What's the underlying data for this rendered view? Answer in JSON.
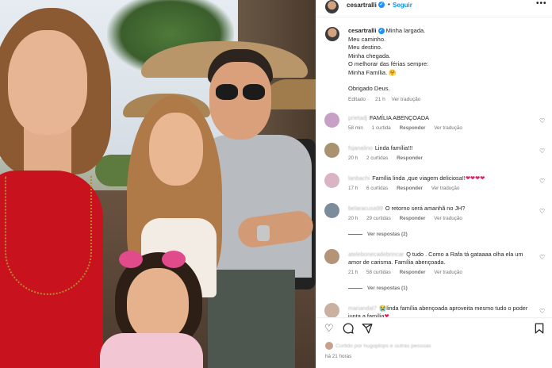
{
  "post": {
    "username": "cesartralli",
    "follow_label": "Seguir",
    "more_label": "•••",
    "caption": {
      "username": "cesartralli",
      "lines": [
        "Minha largada.",
        "Meu caminho.",
        "Meu destino.",
        "Minha chegada.",
        "O melhorar das férias sempre:",
        "Minha Família. 🤗",
        "",
        "Obrigado Deus."
      ],
      "edited": "Editado",
      "age": "21 h",
      "translate": "Ver tradução"
    },
    "comments": [
      {
        "user": "prietadj",
        "text": "FAMÍLIA ABENÇOADA",
        "age": "58 min",
        "likes": "1 curtida",
        "reply": "Responder",
        "translate": "Ver tradução",
        "avatar_color": "#c7a0c6"
      },
      {
        "user": "fsjanalino",
        "text": "Linda família!!!",
        "age": "20 h",
        "likes": "2 curtidas",
        "reply": "Responder",
        "translate": "",
        "avatar_color": "#a8926f"
      },
      {
        "user": "lanbachi",
        "text": "Família linda ,que viagem deliciosa!!",
        "hearts": "❤❤❤❤",
        "age": "17 h",
        "likes": "6 curtidas",
        "reply": "Responder",
        "translate": "Ver tradução",
        "avatar_color": "#d9b4c4"
      },
      {
        "user": "belaracusa99",
        "text": "O retorno será amanhã no JH?",
        "age": "20 h",
        "likes": "29 curtidas",
        "reply": "Responder",
        "translate": "Ver tradução",
        "avatar_color": "#7d8c9a",
        "view_replies": "Ver respostas (2)"
      },
      {
        "user": "atelebonecadebrincar",
        "text": "Q tudo . Como a Rafa tá gataaaa olha ela um amor de carisma. Família abençoada.",
        "age": "21 h",
        "likes": "58 curtidas",
        "reply": "Responder",
        "translate": "Ver tradução",
        "avatar_color": "#b39478",
        "view_replies": "Ver respostas (1)"
      },
      {
        "user": "mariandal7",
        "emoji": "😭",
        "text": "linda família abençoada aproveita mesmo tudo o poder junta a família",
        "hearts": "❤",
        "avatar_color": "#c9b0a0"
      }
    ],
    "actions": {
      "like_icon": "heart-icon",
      "comment_icon": "comment-icon",
      "share_icon": "share-icon",
      "save_icon": "bookmark-icon"
    },
    "liked_by": {
      "prefix": "Curtido por",
      "user": "hugoplops",
      "suffix": "e outras pessoas"
    },
    "timestamp": "há 21 horas"
  },
  "colors": {
    "link_blue": "#0095f6",
    "verified_blue": "#1e90ff",
    "muted": "#737373",
    "heart_red": "#e0245e"
  }
}
